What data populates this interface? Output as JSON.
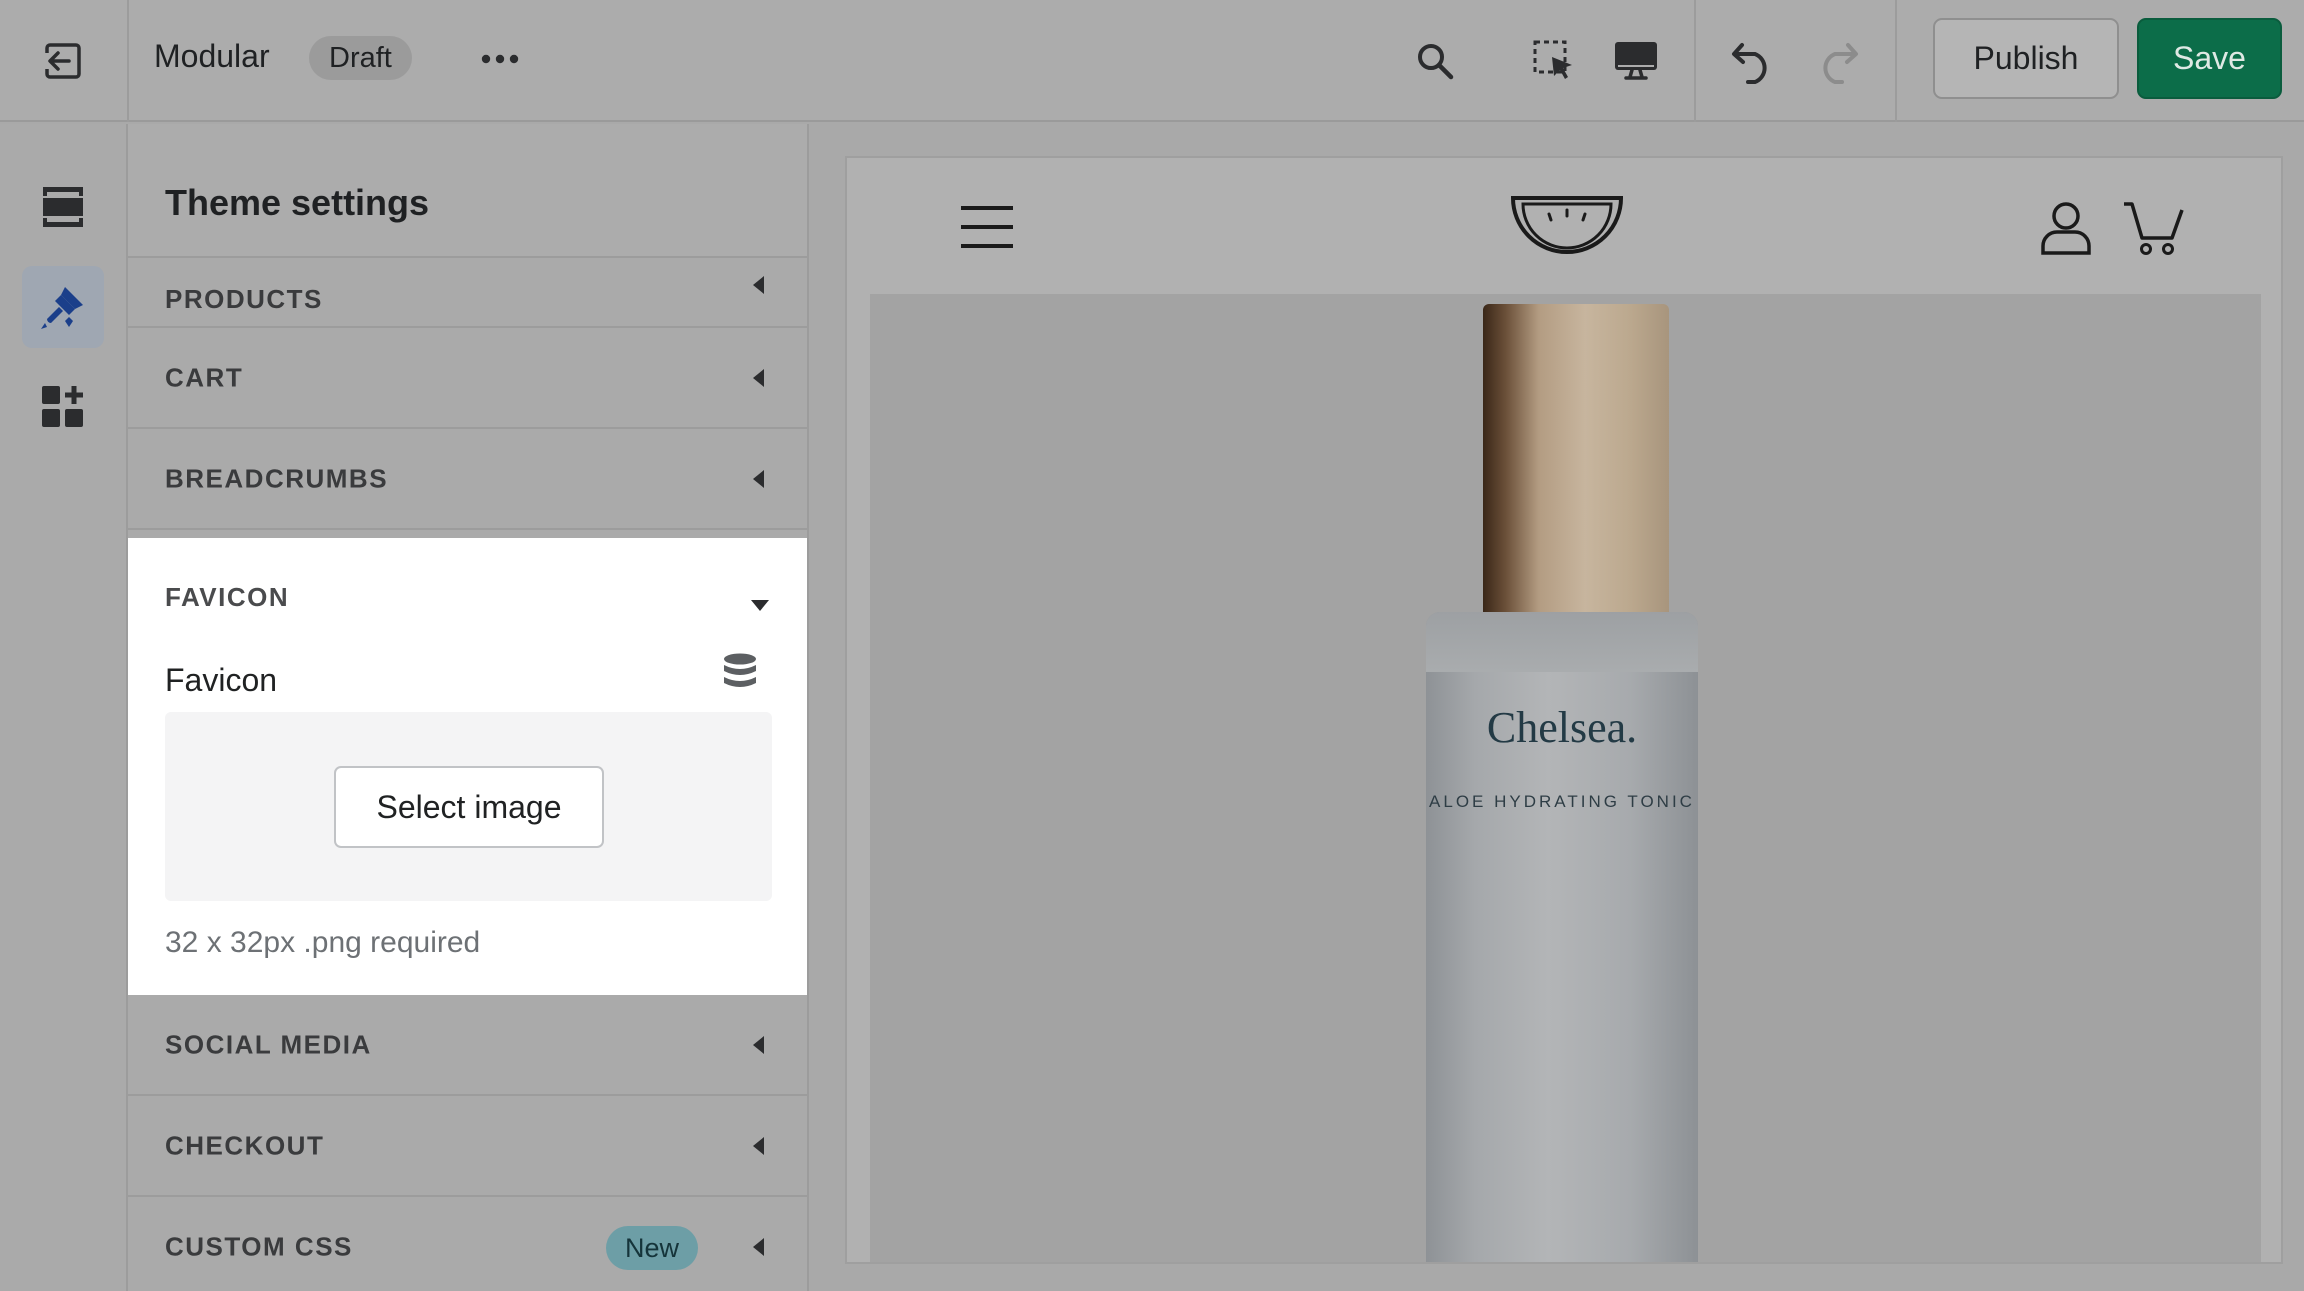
{
  "topbar": {
    "theme_name": "Modular",
    "status_badge": "Draft",
    "publish_label": "Publish",
    "save_label": "Save",
    "save_color": "#0c6d49"
  },
  "sidebar": {
    "title": "Theme settings",
    "sections": {
      "products": "PRODUCTS",
      "cart": "CART",
      "breadcrumbs": "BREADCRUMBS",
      "favicon": "FAVICON",
      "social_media": "SOCIAL MEDIA",
      "checkout": "CHECKOUT",
      "custom_css": "CUSTOM CSS"
    },
    "custom_css_badge": "New",
    "favicon_panel": {
      "field_label": "Favicon",
      "select_button": "Select image",
      "help_text": "32 x 32px .png required"
    }
  },
  "preview": {
    "brand": "Chelsea.",
    "product": "ALOE HYDRATING TONIC"
  }
}
